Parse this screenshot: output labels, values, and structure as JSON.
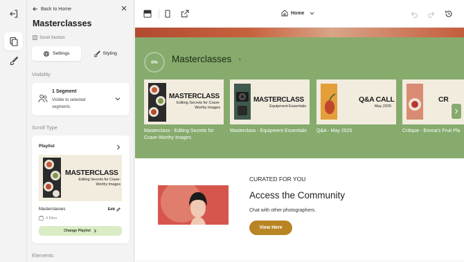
{
  "panel": {
    "back_label": "Back to Home",
    "title": "Masterclasses",
    "section_tag": "Scroll Section",
    "tabs": [
      {
        "label": "Settings",
        "active": true
      },
      {
        "label": "Styling",
        "active": false
      }
    ],
    "visibility": {
      "heading": "Visibility",
      "segment_count": "1 Segment",
      "segment_desc": "Visible to selected segments."
    },
    "scroll_type": {
      "heading": "Scroll Type",
      "playlist_label": "Playlist",
      "thumb": {
        "title": "MASTERCLASS",
        "subtitle": "Editing Secrets for Crave-Worthy Images"
      },
      "name": "Masterclasses",
      "edit_label": "Edit",
      "files": "4 Files",
      "change_button": "Change Playlist"
    },
    "elements_heading": "Elements"
  },
  "topbar": {
    "page_selector": "Home"
  },
  "preview": {
    "progress": "0%",
    "section_title": "Masterclasses",
    "courses": [
      {
        "art_title": "MASTERCLASS",
        "art_sub": "Editing Secrets for Crave-Worthy Images",
        "caption": "Masterclass - Editing Secrets for Crave-Worthy Images"
      },
      {
        "art_title": "MASTERCLASS",
        "art_sub": "Equipment Essentials",
        "caption": "Masterclass - Equipment Essentials"
      },
      {
        "art_title": "Q&A CALL",
        "art_sub": "May 2025",
        "caption": "Q&A - May 2025"
      },
      {
        "art_title": "CR",
        "art_sub": "",
        "caption": "Critique - Emma's Fruit Pla"
      }
    ],
    "community": {
      "eyebrow": "CURATED FOR YOU",
      "title": "Access the Community",
      "body": "Chat with other photographers.",
      "button": "View Here"
    }
  },
  "colors": {
    "section_green": "#86ab6d",
    "cta_gold": "#b98424",
    "change_playlist_bg": "#d9ecc4"
  },
  "icons": [
    "exit-icon",
    "pages-icon",
    "design-brush-icon",
    "arrow-left-icon",
    "close-icon",
    "scroll-section-icon",
    "gear-icon",
    "brush-icon",
    "users-icon",
    "chevron-down-icon",
    "chevron-right-icon",
    "pencil-icon",
    "files-icon",
    "layout-icon",
    "mobile-icon",
    "external-link-icon",
    "home-icon",
    "undo-icon",
    "redo-icon",
    "history-icon"
  ]
}
